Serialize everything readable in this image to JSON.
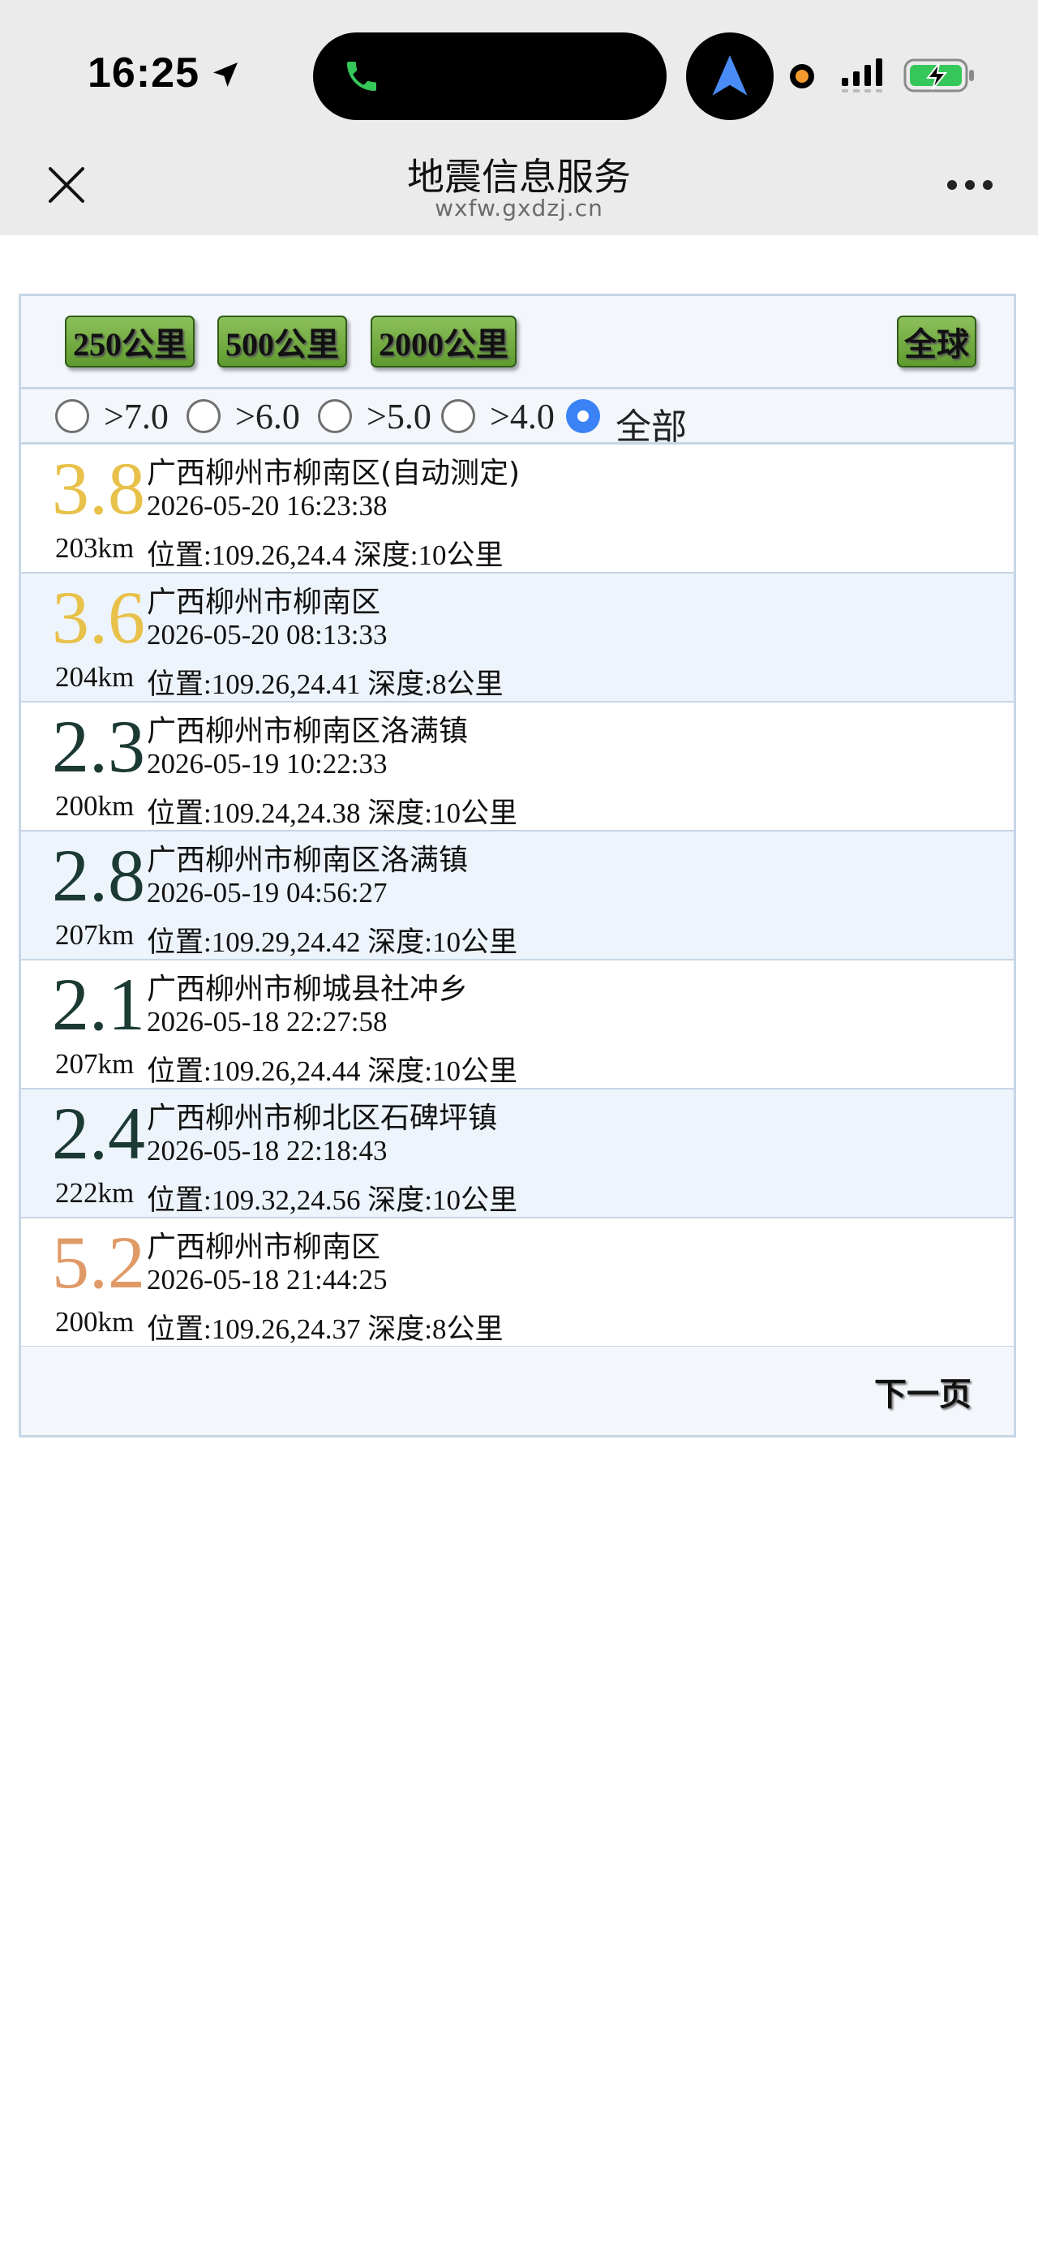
{
  "status_bar": {
    "time": "16:25",
    "icons": [
      "location-arrow-icon",
      "phone-icon",
      "navigation-icon",
      "recording-dot-icon",
      "signal-icon",
      "battery-charging-icon"
    ],
    "accent_colors": {
      "call_green": "#35c759",
      "nav_blue": "#4a8cf5",
      "record_orange": "#f29a2e"
    }
  },
  "title_bar": {
    "title": "地震信息服务",
    "url": "wxfw.gxdzj.cn",
    "close_icon": "close-icon",
    "more_icon": "more-icon"
  },
  "range_buttons": {
    "r250": "250公里",
    "r500": "500公里",
    "r2000": "2000公里",
    "global": "全球",
    "color": "#6fa83e"
  },
  "filters": {
    "gt7": ">7.0",
    "gt6": ">6.0",
    "gt5": ">5.0",
    "gt4": ">4.0",
    "all": "全部",
    "selected": "全部"
  },
  "magnitude_colors": {
    "yellow": "#e8c14a",
    "dark": "#1c3a34",
    "orange": "#e09a68"
  },
  "quakes": [
    {
      "mag": "3.8",
      "place": "广西柳州市柳南区(自动测定)",
      "time": "2026-05-20 16:23:38",
      "dist": "203km",
      "info": "位置:109.26,24.4 深度:10公里",
      "mag_color": "#e8c14a"
    },
    {
      "mag": "3.6",
      "place": "广西柳州市柳南区",
      "time": "2026-05-20 08:13:33",
      "dist": "204km",
      "info": "位置:109.26,24.41 深度:8公里",
      "mag_color": "#e8c14a"
    },
    {
      "mag": "2.3",
      "place": "广西柳州市柳南区洛满镇",
      "time": "2026-05-19 10:22:33",
      "dist": "200km",
      "info": "位置:109.24,24.38 深度:10公里",
      "mag_color": "#1c3a34"
    },
    {
      "mag": "2.8",
      "place": "广西柳州市柳南区洛满镇",
      "time": "2026-05-19 04:56:27",
      "dist": "207km",
      "info": "位置:109.29,24.42 深度:10公里",
      "mag_color": "#1c3a34"
    },
    {
      "mag": "2.1",
      "place": "广西柳州市柳城县社冲乡",
      "time": "2026-05-18 22:27:58",
      "dist": "207km",
      "info": "位置:109.26,24.44 深度:10公里",
      "mag_color": "#1c3a34"
    },
    {
      "mag": "2.4",
      "place": "广西柳州市柳北区石碑坪镇",
      "time": "2026-05-18 22:18:43",
      "dist": "222km",
      "info": "位置:109.32,24.56 深度:10公里",
      "mag_color": "#1c3a34"
    },
    {
      "mag": "5.2",
      "place": "广西柳州市柳南区",
      "time": "2026-05-18 21:44:25",
      "dist": "200km",
      "info": "位置:109.26,24.37 深度:8公里",
      "mag_color": "#e09a68"
    }
  ],
  "pager": {
    "next": "下一页"
  }
}
